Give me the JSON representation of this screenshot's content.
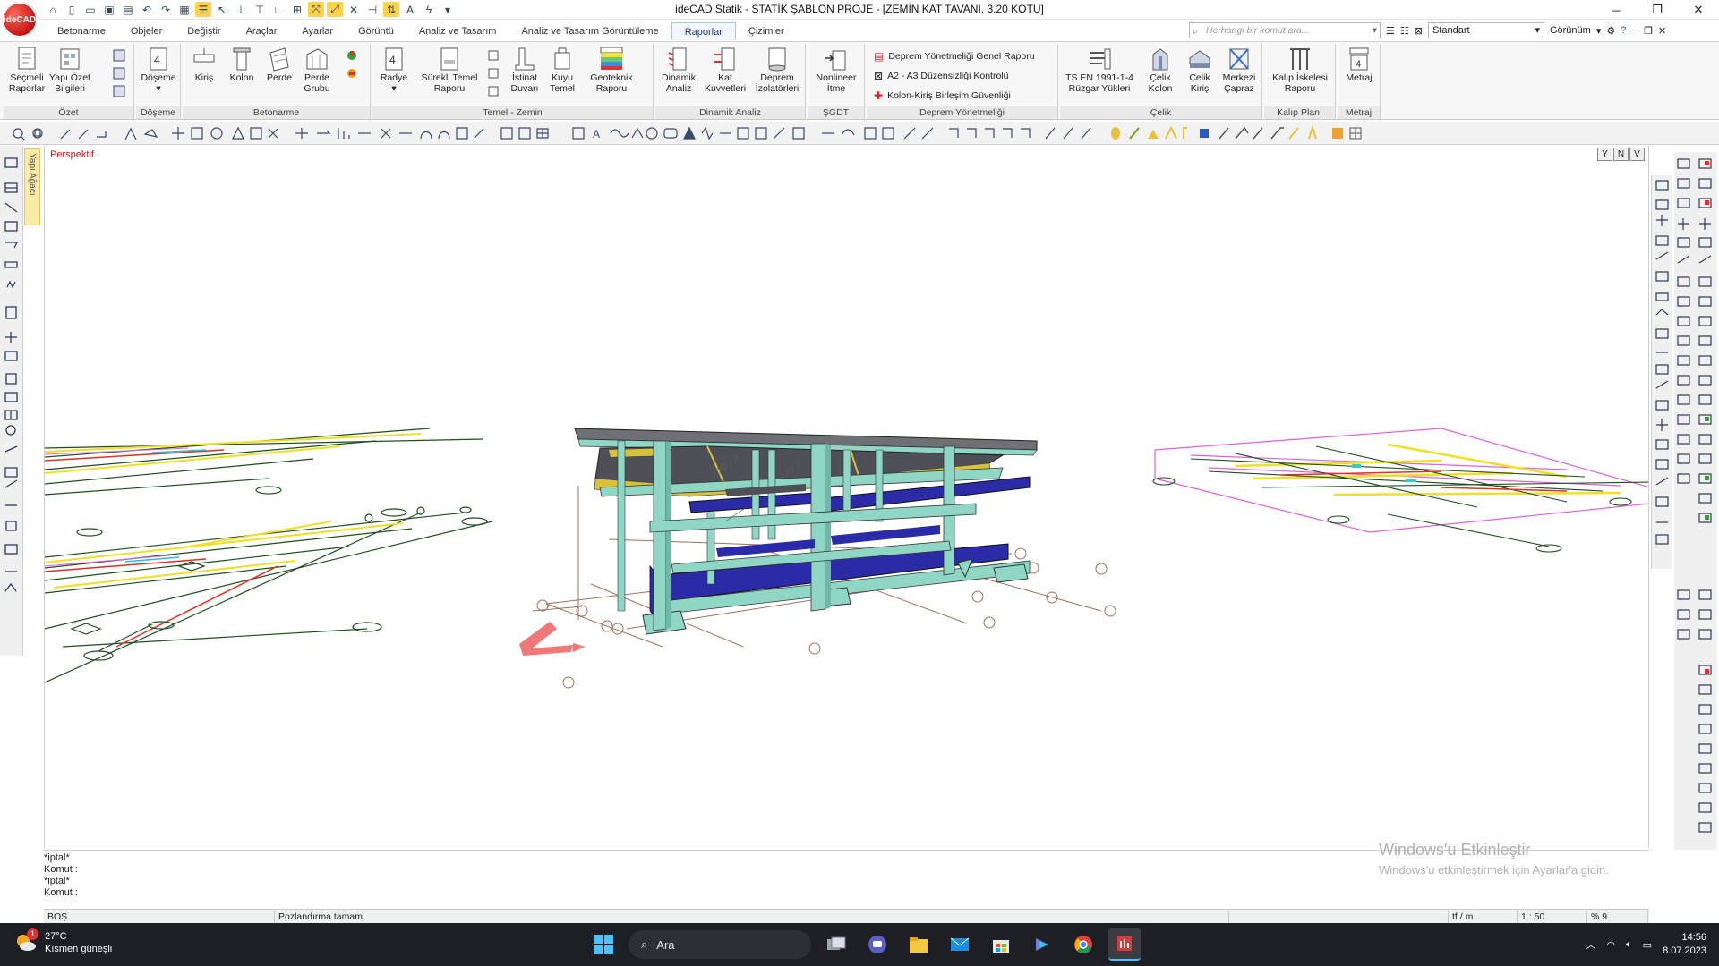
{
  "app": {
    "logo_text": "ideCAD",
    "window_title": "ideCAD Statik - STATİK ŞABLON PROJE - [ZEMİN KAT TAVANI,  3.20 KOTU]"
  },
  "menu": {
    "tabs": [
      "Betonarme",
      "Objeler",
      "Değiştir",
      "Araçlar",
      "Ayarlar",
      "Görüntü",
      "Analiz ve Tasarım",
      "Analiz ve Tasarım Görüntüleme",
      "Raporlar",
      "Çizimler"
    ],
    "active": "Raporlar",
    "search_placeholder": "Herhangi bir komut ara...",
    "style_value": "Standart",
    "view_label": "Görünüm"
  },
  "ribbon": {
    "groups": {
      "ozet": "Özet",
      "doseme": "Döşeme",
      "betonarme": "Betonarme",
      "temel": "Temel - Zemin",
      "dinamik": "Dinamik Analiz",
      "sgdt": "ŞGDT",
      "deprem": "Deprem Yönetmeliği",
      "celik": "Çelik",
      "kalip": "Kalıp Planı",
      "metraj": "Metraj"
    },
    "buttons": {
      "secmeli_1": "Seçmeli",
      "secmeli_2": "Raporlar",
      "yapi_1": "Yapı Özet",
      "yapi_2": "Bilgileri",
      "doseme": "Döşeme",
      "kiris": "Kiriş",
      "kolon": "Kolon",
      "perde": "Perde",
      "perde_grubu_1": "Perde",
      "perde_grubu_2": "Grubu",
      "radye": "Radye",
      "surekli_1": "Sürekli Temel",
      "surekli_2": "Raporu",
      "istinat_1": "İstinat",
      "istinat_2": "Duvarı",
      "kuyu_1": "Kuyu",
      "kuyu_2": "Temel",
      "geoteknik_1": "Geoteknik",
      "geoteknik_2": "Raporu",
      "dinamik_1": "Dinamik",
      "dinamik_2": "Analiz",
      "kat_1": "Kat",
      "kat_2": "Kuvvetleri",
      "izolator_1": "Deprem",
      "izolator_2": "İzolatörleri",
      "nonlineer_1": "Nonlineer",
      "nonlineer_2": "İtme",
      "deprem_list_1": "Deprem Yönetmeliği Genel Raporu",
      "deprem_list_2": "A2 - A3 Düzensizliği Kontrolü",
      "deprem_list_3": "Kolon-Kiriş Birleşim Güvenliği",
      "ruzgar_1": "TS EN 1991-1-4",
      "ruzgar_2": "Rüzgar Yükleri",
      "celik_kolon_1": "Çelik",
      "celik_kolon_2": "Kolon",
      "celik_kiris_1": "Çelik",
      "celik_kiris_2": "Kiriş",
      "merkezi_1": "Merkezi",
      "merkezi_2": "Çapraz",
      "kalip_1": "Kalıp İskelesi",
      "kalip_2": "Raporu",
      "metraj": "Metraj"
    }
  },
  "left_panel": {
    "tab": "Yapı Ağacı"
  },
  "viewport": {
    "view_name": "Perspektif",
    "view_buttons": [
      "Y",
      "N",
      "V"
    ]
  },
  "command": {
    "lines": [
      "*iptal*",
      "Komut :",
      "*iptal*",
      "Komut :"
    ]
  },
  "watermark": {
    "line1": "Windows'u Etkinleştir",
    "line2": "Windows'u etkinleştirmek için Ayarlar'a gidin."
  },
  "status": {
    "mode": "BOŞ",
    "message": "Pozlandırma tamam.",
    "unit": "tf / m",
    "scale": "1 : 50",
    "zoom": "% 9"
  },
  "taskbar": {
    "weather_temp": "27°C",
    "weather_desc": "Kısmen güneşli",
    "weather_badge": "1",
    "search_label": "Ara",
    "time": "14:56",
    "date": "8.07.2023"
  },
  "colors": {
    "column": "#8fd6c4",
    "beam_blue": "#2b2ba8",
    "slab_dark": "#4d5057",
    "slab_edge": "#d9c23a",
    "axis_red": "#f07878",
    "accent": "#1c3f8c"
  }
}
